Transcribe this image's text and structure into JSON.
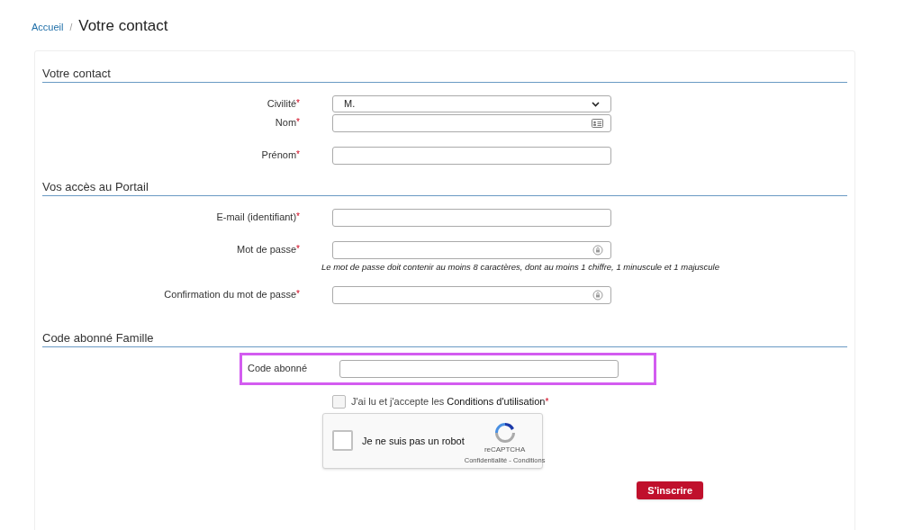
{
  "breadcrumb": {
    "home": "Accueil",
    "separator": "/",
    "current": "Votre contact"
  },
  "sections": [
    {
      "title": "Votre contact",
      "fields": [
        {
          "kind": "select",
          "label": "Civilité",
          "required_mark": "*",
          "value": "M."
        },
        {
          "kind": "card",
          "label": "Nom",
          "required_mark": "*"
        },
        {
          "kind": "text",
          "label": "Prénom",
          "required_mark": "*"
        }
      ]
    },
    {
      "title": "Vos accès au Portail",
      "fields": [
        {
          "kind": "text",
          "label": "E-mail (identifiant)",
          "required_mark": "*"
        },
        {
          "kind": "password",
          "label": "Mot de passe",
          "required_mark": "*",
          "hint": "Le mot de passe doit contenir au moins 8 caractères, dont au moins 1 chiffre, 1 minuscule et 1 majuscule"
        },
        {
          "kind": "password",
          "label": "Confirmation du mot de passe",
          "required_mark": "*"
        }
      ]
    },
    {
      "title": "Code abonné Famille",
      "fields": [
        {
          "kind": "text",
          "label": "Code abonné",
          "highlighted": true
        }
      ]
    }
  ],
  "terms": {
    "checked": false,
    "text": "J'ai lu et j'accepte les",
    "link": "Conditions d'utilisation",
    "required_mark": "*"
  },
  "captcha": {
    "checked": false,
    "label": "Je ne suis pas un robot",
    "brand": "reCAPTCHA",
    "links": "Confidentialité - Conditions"
  },
  "submit": "S'inscrire"
}
